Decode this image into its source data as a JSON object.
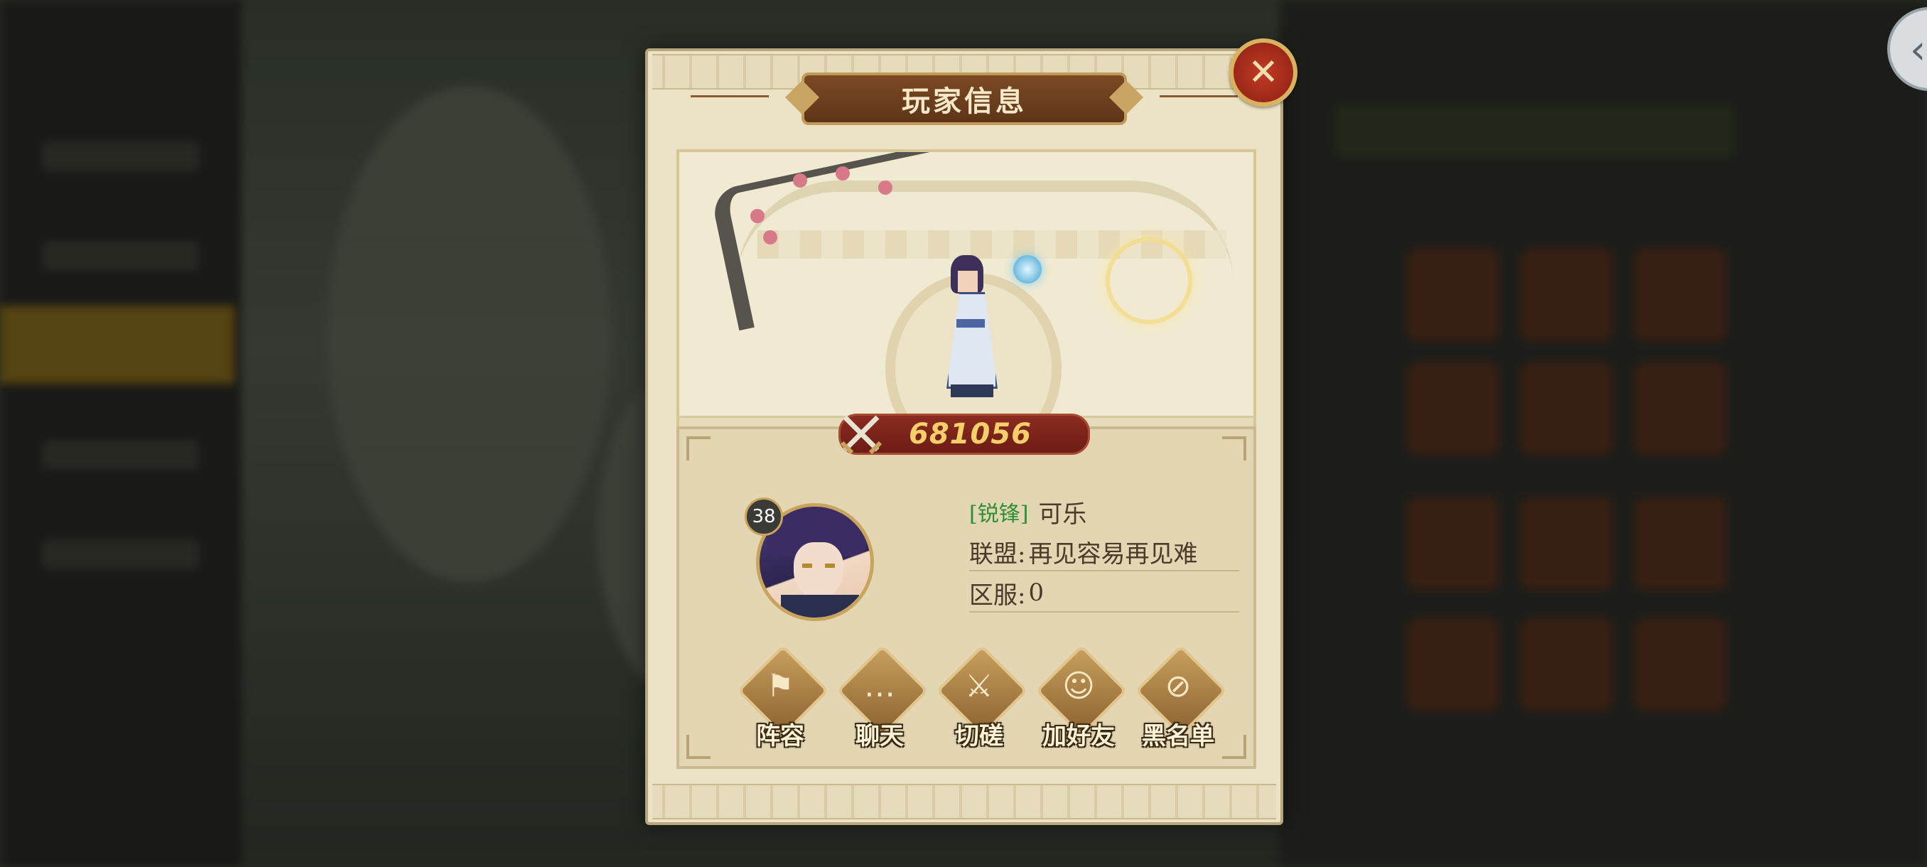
{
  "dialog": {
    "title": "玩家信息",
    "close_icon": "close-icon"
  },
  "player": {
    "power": "681056",
    "level": "38",
    "title_tag": "[锐锋]",
    "name": "可乐",
    "alliance_label": "联盟:",
    "alliance_value": "再见容易再见难",
    "server_label": "区服:",
    "server_value": "0"
  },
  "actions": [
    {
      "label": "阵容",
      "icon": "flag-icon"
    },
    {
      "label": "聊天",
      "icon": "chat-icon"
    },
    {
      "label": "切磋",
      "icon": "crossed-swords-icon"
    },
    {
      "label": "加好友",
      "icon": "add-friend-icon"
    },
    {
      "label": "黑名单",
      "icon": "blacklist-icon"
    }
  ],
  "colors": {
    "accent": "#c9a45d",
    "power_text": "#f4cf6a",
    "tag_green": "#2f8f37"
  }
}
